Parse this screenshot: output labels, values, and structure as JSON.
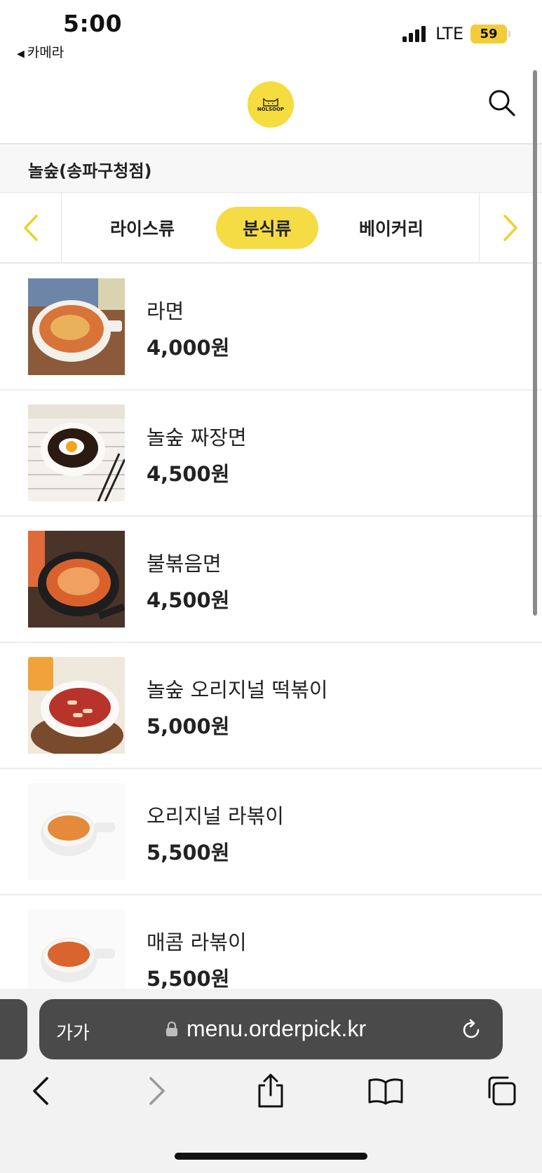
{
  "status_bar": {
    "time": "5:00",
    "back_app": "카메라",
    "network": "LTE",
    "battery": "59"
  },
  "header": {
    "logo_text": "NOLSOOP",
    "logo_icon": "cat-logo-icon",
    "search_icon": "search-icon"
  },
  "store": {
    "name": "놀숲(송파구청점)"
  },
  "categories": {
    "items": [
      "라이스류",
      "분식류",
      "베이커리"
    ],
    "active": "분식류",
    "accent_color": "#f5dc44"
  },
  "menu": {
    "items": [
      {
        "name": "라면",
        "price": "4,000원"
      },
      {
        "name": "놀숲 짜장면",
        "price": "4,500원"
      },
      {
        "name": "불볶음면",
        "price": "4,500원"
      },
      {
        "name": "놀숲 오리지널 떡볶이",
        "price": "5,000원"
      },
      {
        "name": "오리지널 라볶이",
        "price": "5,500원"
      },
      {
        "name": "매콤 라볶이",
        "price": "5,500원"
      }
    ]
  },
  "browser": {
    "text_size_label": "가가",
    "url": "menu.orderpick.kr"
  }
}
